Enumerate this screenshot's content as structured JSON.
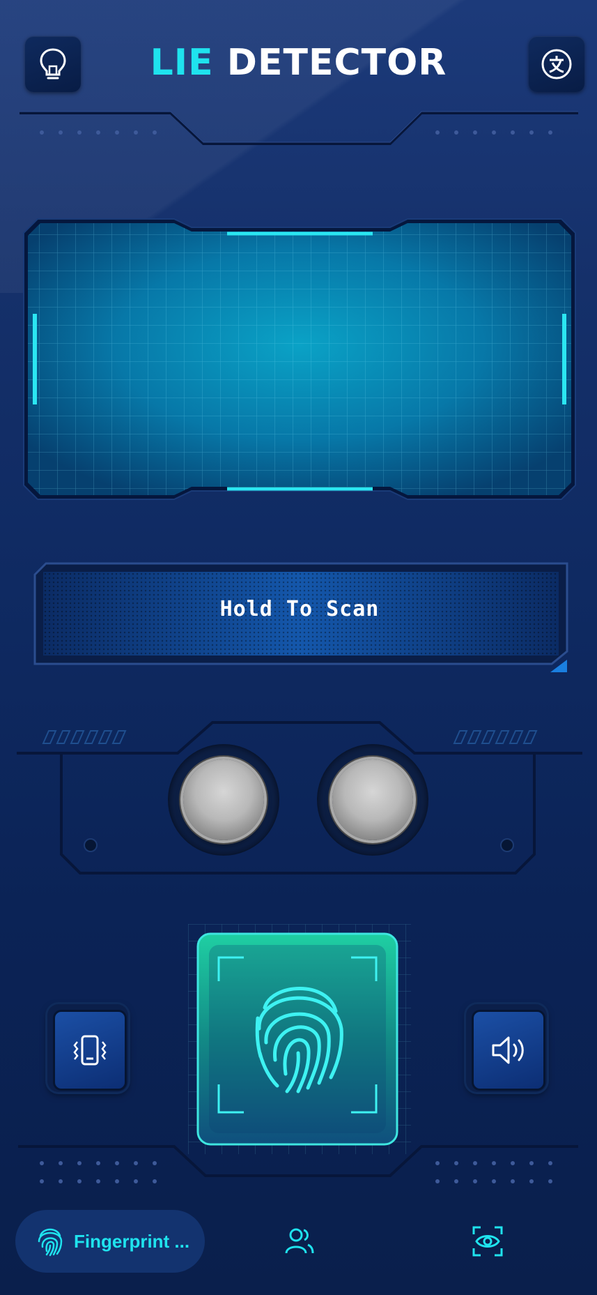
{
  "header": {
    "title_accent": "LIE",
    "title_main": "DETECTOR",
    "left_icon": "lightbulb-icon",
    "right_icon": "translate-icon"
  },
  "scan": {
    "status_text": "Hold To Scan"
  },
  "controls": {
    "left_icon": "vibrate-icon",
    "center_icon": "fingerprint-icon",
    "right_icon": "speaker-icon"
  },
  "nav": {
    "active_label": "Fingerprint ...",
    "items": [
      "fingerprint-icon",
      "users-icon",
      "eye-scan-icon"
    ]
  },
  "colors": {
    "accent": "#1fe3ee",
    "background": "#0f2a62",
    "scanner_green": "#1fd8a8"
  }
}
